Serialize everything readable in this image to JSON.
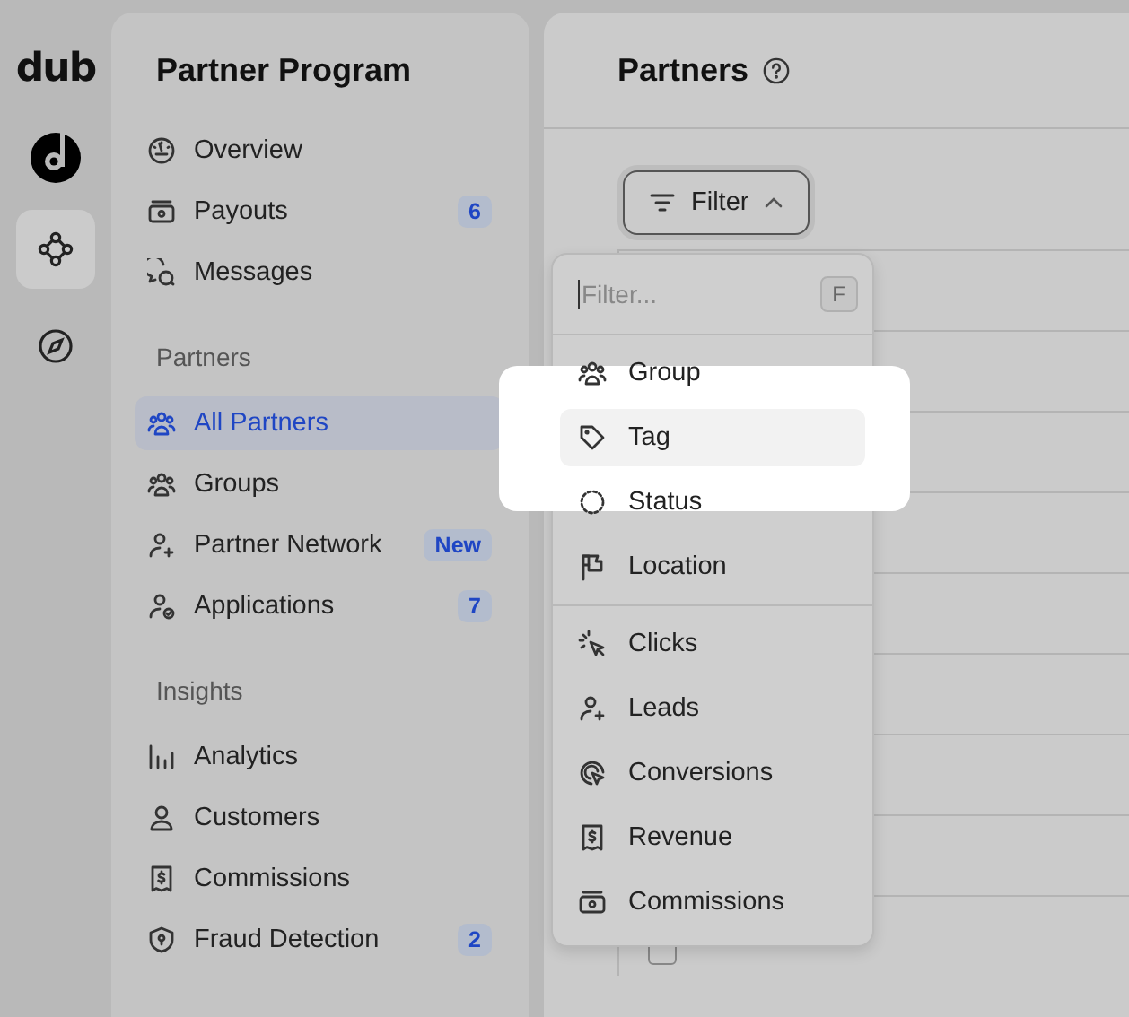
{
  "rail": {
    "logo": "dub",
    "items": [
      {
        "selected": false
      },
      {
        "selected": true
      },
      {
        "selected": false
      }
    ]
  },
  "sidebar": {
    "title": "Partner Program",
    "sections": [
      {
        "items": [
          {
            "label": "Overview",
            "selected": false
          },
          {
            "label": "Payouts",
            "badge": "6",
            "selected": false
          },
          {
            "label": "Messages",
            "selected": false
          }
        ]
      },
      {
        "heading": "Partners",
        "items": [
          {
            "label": "All Partners",
            "selected": true
          },
          {
            "label": "Groups",
            "selected": false
          },
          {
            "label": "Partner Network",
            "badge": "New",
            "selected": false
          },
          {
            "label": "Applications",
            "badge": "7",
            "selected": false
          }
        ]
      },
      {
        "heading": "Insights",
        "items": [
          {
            "label": "Analytics",
            "selected": false
          },
          {
            "label": "Customers",
            "selected": false
          },
          {
            "label": "Commissions",
            "selected": false
          },
          {
            "label": "Fraud Detection",
            "badge": "2",
            "selected": false
          }
        ]
      }
    ]
  },
  "page": {
    "title": "Partners",
    "filter_button": "Filter"
  },
  "table": {
    "rows": [
      {
        "checked": false
      }
    ]
  },
  "filter_menu": {
    "search": {
      "placeholder": "Filter...",
      "shortcut": "F"
    },
    "groups": [
      [
        {
          "label": "Group",
          "selected": false
        },
        {
          "label": "Tag",
          "selected": true
        },
        {
          "label": "Status",
          "selected": false
        },
        {
          "label": "Location",
          "selected": false
        }
      ],
      [
        {
          "label": "Clicks",
          "selected": false
        },
        {
          "label": "Leads",
          "selected": false
        },
        {
          "label": "Conversions",
          "selected": false
        },
        {
          "label": "Revenue",
          "selected": false
        },
        {
          "label": "Commissions",
          "selected": false
        }
      ]
    ]
  }
}
